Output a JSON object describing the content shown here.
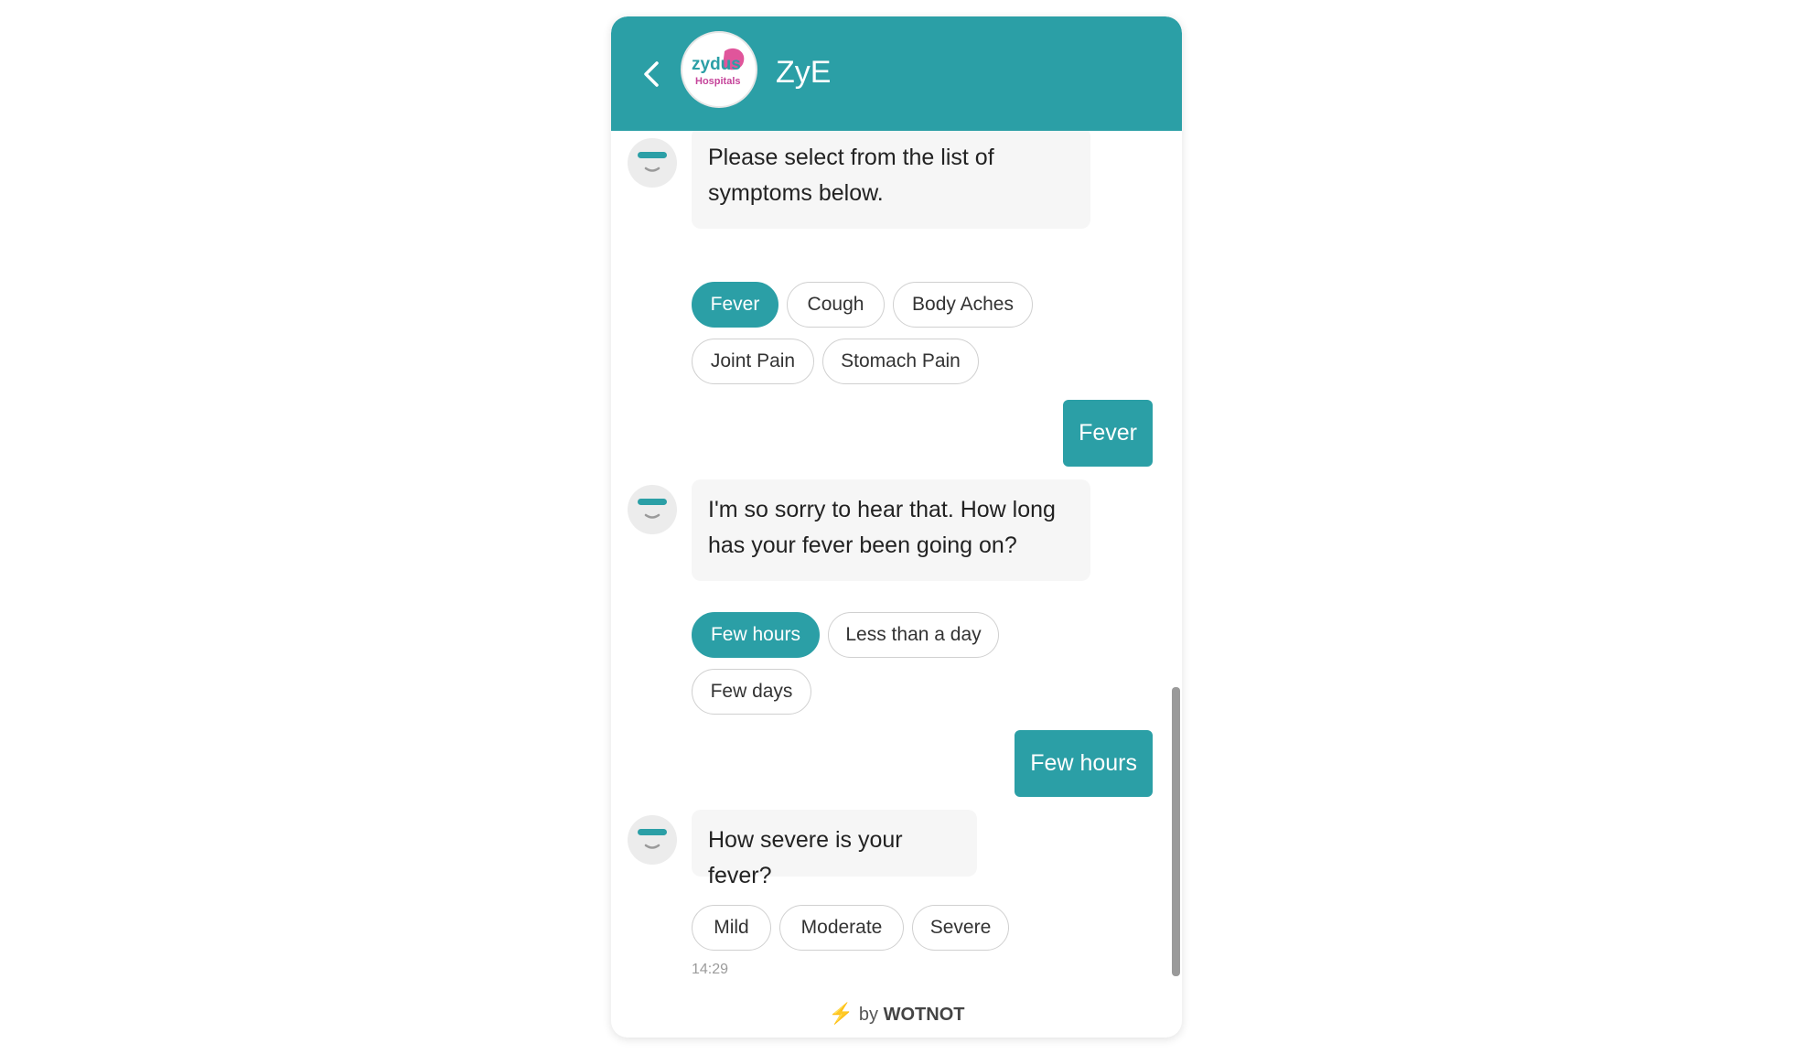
{
  "header": {
    "title": "ZyE",
    "back_icon": "chevron-left-icon",
    "logo": {
      "line1": "zydus",
      "line2": "Hospitals"
    },
    "color": "#2b9fa6"
  },
  "messages": {
    "bot1": {
      "text": "Please select from the list of symptoms below."
    },
    "chips1": [
      "Fever",
      "Cough",
      "Body Aches",
      "Joint Pain",
      "Stomach Pain"
    ],
    "user1": "Fever",
    "bot2": {
      "text": "I'm so sorry to hear that. How long has your fever been going on?"
    },
    "chips2": [
      "Few hours",
      "Less than a day",
      "Few days"
    ],
    "user2": "Few hours",
    "bot3": {
      "text": "How severe is your fever?"
    },
    "chips3": [
      "Mild",
      "Moderate",
      "Severe"
    ],
    "timestamp": "14:29"
  },
  "footer": {
    "bolt_icon": "lightning-icon",
    "by": "by",
    "brand": "WOTNOT"
  },
  "colors": {
    "accent": "#2b9fa6",
    "bot_bubble": "#f6f6f6",
    "chip_border": "#d0d0d0"
  }
}
